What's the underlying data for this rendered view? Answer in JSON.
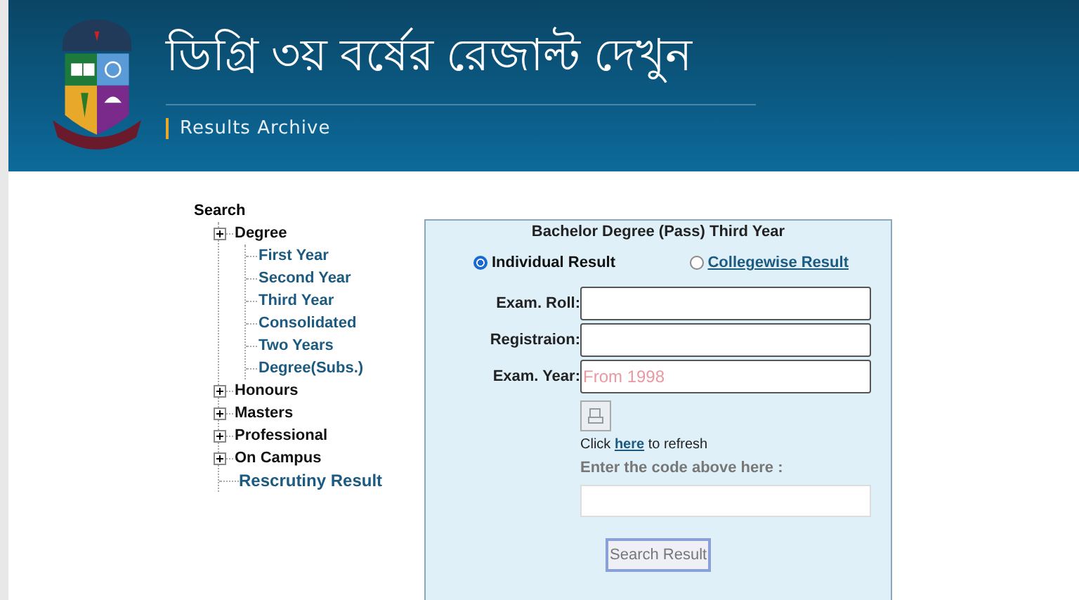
{
  "header": {
    "title": "ডিগ্রি ৩য় বর্ষের রেজাল্ট দেখুন",
    "subtitle": "Results Archive"
  },
  "tree": {
    "title": "Search",
    "items": [
      {
        "label": "Degree",
        "kind": "folder",
        "expanded": true,
        "children": [
          {
            "label": "First Year"
          },
          {
            "label": "Second Year"
          },
          {
            "label": "Third Year"
          },
          {
            "label": "Consolidated"
          },
          {
            "label": "Two Years"
          },
          {
            "label": "Degree(Subs.)"
          }
        ]
      },
      {
        "label": "Honours",
        "kind": "folder"
      },
      {
        "label": "Masters",
        "kind": "folder"
      },
      {
        "label": "Professional",
        "kind": "folder"
      },
      {
        "label": "On Campus",
        "kind": "folder"
      },
      {
        "label": "Rescrutiny Result",
        "kind": "link"
      }
    ]
  },
  "form": {
    "title": "Bachelor Degree (Pass) Third Year",
    "options": [
      {
        "label": "Individual Result",
        "kind": "text",
        "selected": true
      },
      {
        "label": "Collegewise Result",
        "kind": "link",
        "selected": false
      }
    ],
    "fields": [
      {
        "label": "Exam. Roll:"
      },
      {
        "label": "Registraion:"
      },
      {
        "label": "Exam. Year:",
        "placeholder": "From 1998"
      }
    ],
    "refresh": {
      "before": "Click",
      "link": "here",
      "after": "to refresh"
    },
    "code_label": "Enter the code above here :",
    "button": "Search Result"
  }
}
